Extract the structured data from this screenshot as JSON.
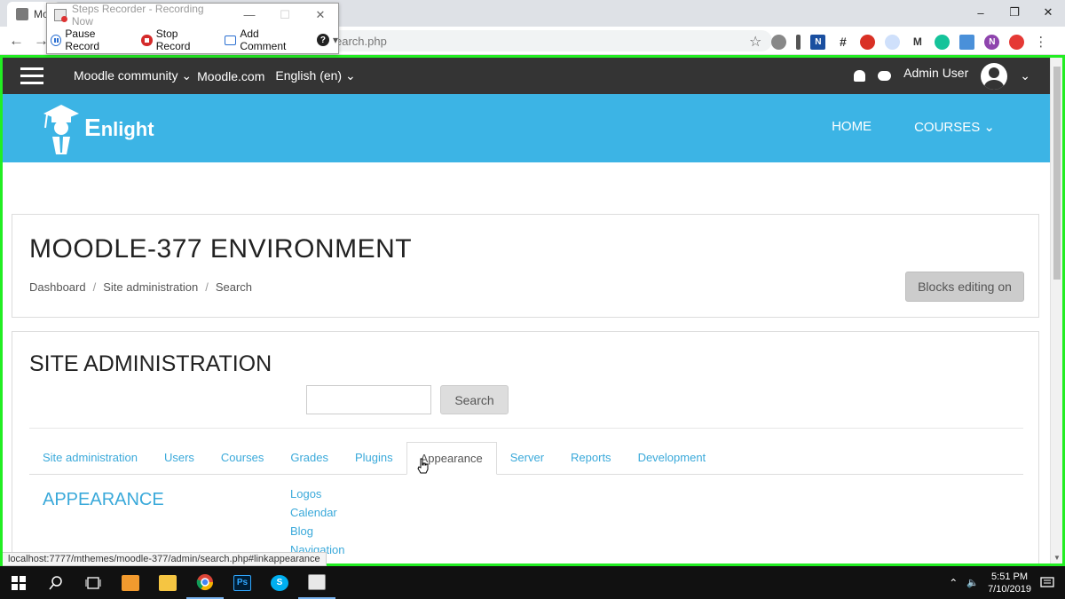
{
  "browser": {
    "tab_title": "Mo",
    "url_fragment": "earch.php",
    "win_minimize": "–",
    "win_restore": "❐",
    "win_close": "✕",
    "back_glyph": "←",
    "forward_glyph": "→",
    "star_glyph": "☆",
    "menu_glyph": "⋮",
    "extension_labels": [
      "",
      "",
      "N",
      "#",
      "",
      "",
      "M",
      "",
      "",
      "N",
      ""
    ]
  },
  "steps_recorder": {
    "title": "Steps Recorder - Recording Now",
    "pause_label": "Pause Record",
    "stop_label": "Stop Record",
    "comment_label": "Add Comment",
    "help_glyph": "?",
    "dropdown_glyph": "▾",
    "min_glyph": "—",
    "max_glyph": "☐",
    "close_glyph": "✕"
  },
  "moodle_nav": {
    "community_label": "Moodle community",
    "community_caret": "⌄",
    "moodle_com_label": "Moodle.com",
    "language_label": "English (en)",
    "language_caret": "⌄",
    "user_name": "Admin User",
    "user_caret": "⌄"
  },
  "brand": {
    "logo_first_letter": "E",
    "logo_rest": "nlight",
    "menu_home": "HOME",
    "menu_courses": "COURSES",
    "courses_caret": "⌄"
  },
  "header_card": {
    "title": "MOODLE-377 ENVIRONMENT",
    "breadcrumb": [
      "Dashboard",
      "Site administration",
      "Search"
    ],
    "breadcrumb_sep": "/",
    "blocks_editing_label": "Blocks editing on"
  },
  "admin_card": {
    "title": "SITE ADMINISTRATION",
    "search_value": "",
    "search_button": "Search",
    "tabs": [
      {
        "label": "Site administration"
      },
      {
        "label": "Users"
      },
      {
        "label": "Courses"
      },
      {
        "label": "Grades"
      },
      {
        "label": "Plugins"
      },
      {
        "label": "Appearance"
      },
      {
        "label": "Server"
      },
      {
        "label": "Reports"
      },
      {
        "label": "Development"
      }
    ],
    "active_tab": "Appearance",
    "section_title": "APPEARANCE",
    "section_links": [
      "Logos",
      "Calendar",
      "Blog",
      "Navigation"
    ]
  },
  "status_url": "localhost:7777/mthemes/moodle-377/admin/search.php#linkappearance",
  "taskbar": {
    "ps_label": "Ps",
    "skype_label": "S",
    "time": "5:51 PM",
    "date": "7/10/2019",
    "tray_chevron": "⌃",
    "volume_glyph": "🔈"
  },
  "colors": {
    "accent_blue": "#3cb4e5",
    "nav_dark": "#343434",
    "link_blue": "#3aa9da",
    "frame_green": "#22ee22"
  }
}
